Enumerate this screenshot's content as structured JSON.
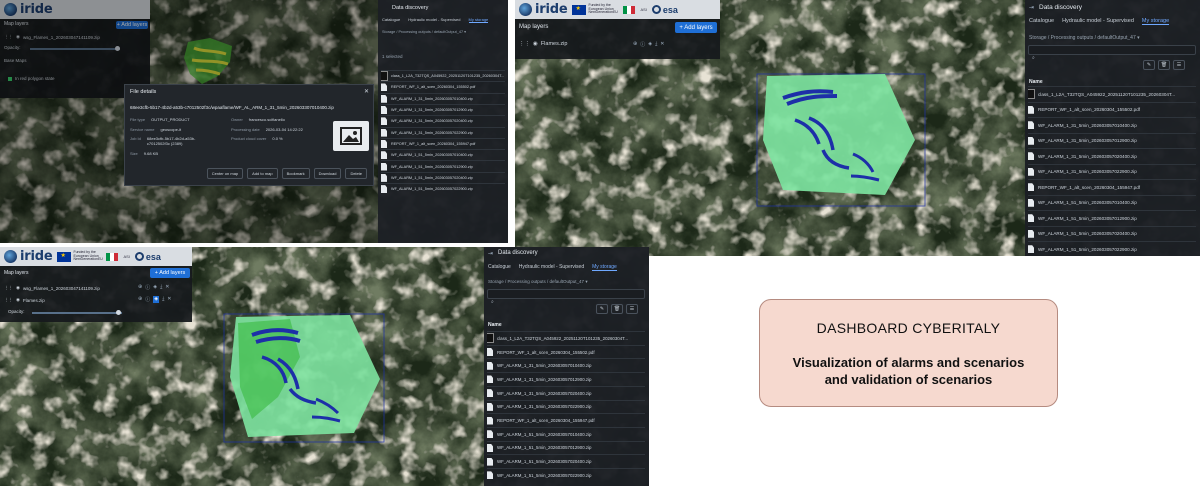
{
  "header": {
    "logo": "iride",
    "eu_text": "Funded by the European Union NextGenerationEU",
    "it_text": "Italia Domani",
    "asi_text": "ASI",
    "esa": "esa"
  },
  "left_top": {
    "layers_title": "Map layers",
    "add_layers": "+ Add layers",
    "layer1": "wsg_Flames_1_202603047141109.zip",
    "opacity_label": "Opacity:",
    "base_maps": "Base Maps",
    "legend_item": "In red polygon state"
  },
  "modal": {
    "title": "File details",
    "filename": "68ee3cfb-5b17-4b2d-a53b-c7012502f3c/wpaaflame/WF_AL_ARM_1_31_5min_202603307010400.zip",
    "fields": [
      {
        "k": "File type",
        "v": "OUTPUT_PRODUCT"
      },
      {
        "k": "Owner",
        "v": "francesco.scifianello"
      },
      {
        "k": "Service name",
        "v": "geoscope-it"
      },
      {
        "k": "Processing date",
        "v": "2026-03-04 14:22:22"
      },
      {
        "k": "Job Id",
        "v": "68ee3cfb-5b17-4b2d-a53b-c7012502f3c (2389)"
      },
      {
        "k": "Product cloud cover",
        "v": "0.0 %"
      },
      {
        "k": "Size",
        "v": "9.68 KB"
      }
    ],
    "buttons": [
      "Center on map",
      "Add to map",
      "Bookmark",
      "Download",
      "Delete"
    ]
  },
  "data_discovery": {
    "title": "Data discovery",
    "tabs": [
      "Catalogue",
      "Hydraulic model - Supervised",
      "My storage"
    ],
    "breadcrumb": "Storage  /  Processing outputs  /  defaultOutput_47  ▾",
    "column": "Name",
    "selected_count": "1 selected",
    "files": [
      "class_1_L2A_T32TQS_A045922_20251120T101235_20260304T...",
      "REPORT_WF_1_alt_scen_20260304_155502.pdf",
      "WF_ALARM_1_31_5min_202603057010400.zip",
      "WF_ALARM_1_31_5min_202603057012900.zip",
      "WF_ALARM_1_31_5min_202603057020400.zip",
      "WF_ALARM_1_31_5min_202603057022900.zip",
      "REPORT_WF_1_alt_scen_20260304_155947.pdf",
      "WF_ALARM_1_51_5min_202603057010400.zip",
      "WF_ALARM_1_51_5min_202603057012900.zip",
      "WF_ALARM_1_51_5min_202603057020400.zip",
      "WF_ALARM_1_51_5min_202603057022900.zip"
    ]
  },
  "right_top": {
    "layers_title": "Map layers",
    "add_layers": "+ Add layers",
    "layer1": "Flames.zip"
  },
  "bottom": {
    "layers_title": "Map layers",
    "add_layers": "+ Add layers",
    "layer1": "wsg_Flames_1_202603047141109.zip",
    "layer2": "Flames.zip",
    "opacity_label": "Opacity:"
  },
  "dashboard": {
    "title": "DASHBOARD CYBERITALY",
    "subtitle_line1": "Visualization of alarms and scenarios",
    "subtitle_line2": "and validation of scenarios"
  },
  "colors": {
    "accent_blue": "#1f6fd6",
    "burn_green": "#7de3a0",
    "burn_blue": "#1d2fa8",
    "card_fill": "#f6d9cf"
  }
}
